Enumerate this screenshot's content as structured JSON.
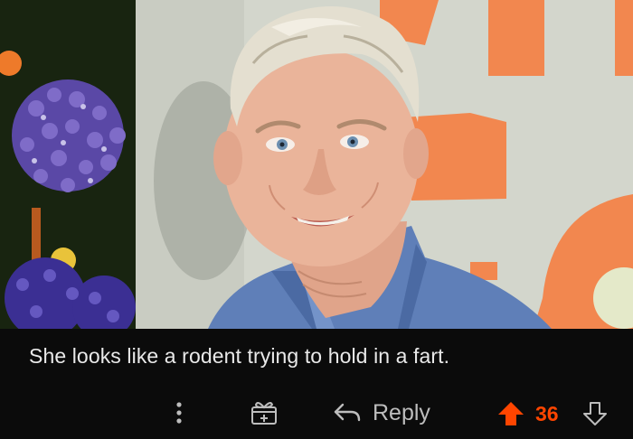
{
  "photo": {
    "subject": "portrait-photo"
  },
  "comment": {
    "text": "She looks like a rodent trying to hold in a fart."
  },
  "actions": {
    "more_icon": "more-vertical-icon",
    "award_icon": "gift-award-icon",
    "reply_icon": "reply-arrow-icon",
    "reply_label": "Reply",
    "upvote_icon": "upvote-arrow-icon",
    "score": "36",
    "downvote_icon": "downvote-arrow-icon"
  },
  "colors": {
    "background": "#0b0b0b",
    "text": "#e9e9e9",
    "muted": "#bdbdbd",
    "upvote": "#ff4500"
  }
}
